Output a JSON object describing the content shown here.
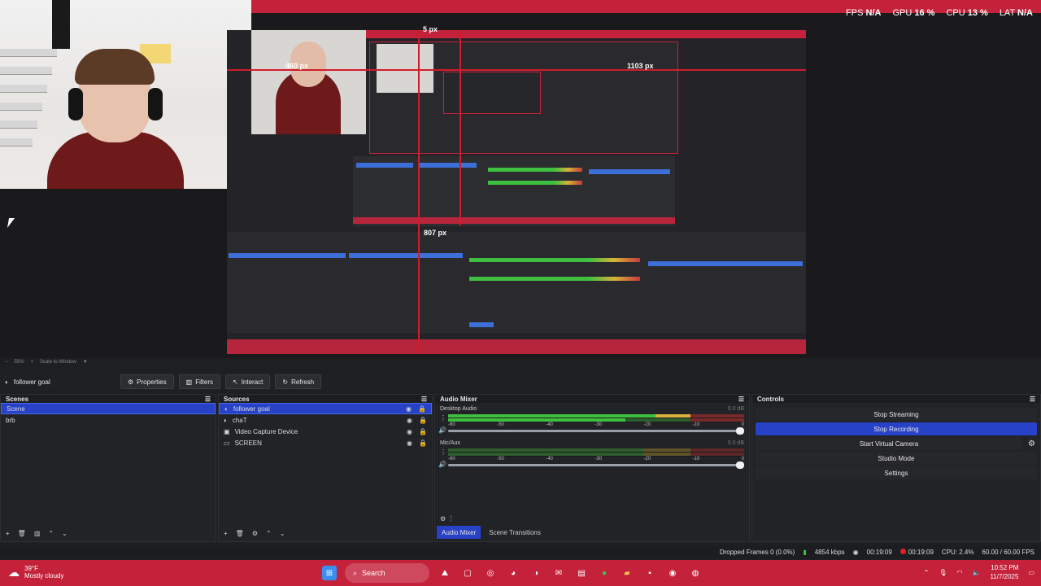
{
  "stats": {
    "fps_label": "FPS",
    "fps_value": "N/A",
    "gpu_label": "GPU",
    "gpu_value": "16 %",
    "cpu_label": "CPU",
    "cpu_value": "13 %",
    "lat_label": "LAT",
    "lat_value": "N/A"
  },
  "preview_labels": {
    "guide_top": "5 px",
    "guide_left": "460 px",
    "guide_right": "1103 px",
    "guide_bottom": "807 px"
  },
  "preview_footer": {
    "zoom": "55%",
    "scale_mode": "Scale to Window"
  },
  "source_toolbar": {
    "source_name": "follower goal",
    "properties": "Properties",
    "filters": "Filters",
    "interact": "Interact",
    "refresh": "Refresh"
  },
  "scenes": {
    "title": "Scenes",
    "items": [
      "Scene",
      "brb"
    ]
  },
  "sources": {
    "title": "Sources",
    "items": [
      "follower goal",
      "chaT",
      "Video Capture Device",
      "SCREEN"
    ]
  },
  "audio_mixer": {
    "title": "Audio Mixer",
    "channels": [
      {
        "name": "Desktop Audio",
        "db": "0.0 dB",
        "level": 0.8
      },
      {
        "name": "Mic/Aux",
        "db": "0.0 dB",
        "level": 0.0
      }
    ],
    "scale": [
      "-60",
      "-55",
      "-50",
      "-45",
      "-40",
      "-35",
      "-30",
      "-25",
      "-20",
      "-15",
      "-10",
      "-5",
      "0"
    ],
    "tab_active": "Audio Mixer",
    "tab_other": "Scene Transitions"
  },
  "controls": {
    "title": "Controls",
    "buttons": [
      "Stop Streaming",
      "Stop Recording",
      "Start Virtual Camera",
      "Studio Mode",
      "Settings"
    ]
  },
  "status_bar": {
    "dropped": "Dropped Frames 0 (0.0%)",
    "bitrate": "4854 kbps",
    "stream_time": "00:19:09",
    "rec_time": "00:19:09",
    "cpu": "CPU: 2.4%",
    "fps": "60.00 / 60.00 FPS"
  },
  "taskbar": {
    "temp": "39°F",
    "weather": "Mostly cloudy",
    "search": "Search",
    "time": "10:52 PM",
    "date": "11/7/2025"
  },
  "colors": {
    "accent_red": "#c4213a",
    "selection_blue": "#2741c7",
    "meter_green": "#3fbf3f"
  }
}
